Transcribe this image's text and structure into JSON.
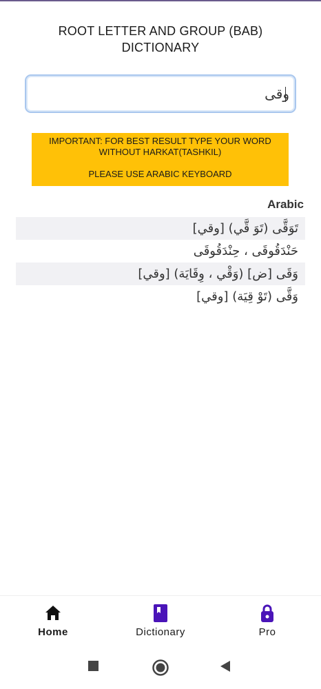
{
  "header": {
    "title_line1": "ROOT LETTER AND GROUP (BAB)",
    "title_line2": "DICTIONARY"
  },
  "search": {
    "value": "وقى",
    "border_color": "#a9c7ee"
  },
  "notice": {
    "line1": "IMPORTANT: FOR BEST RESULT TYPE YOUR WORD",
    "line2": "WITHOUT HARKAT(TASHKIL)",
    "line3": "PLEASE USE ARABIC KEYBOARD",
    "background": "#ffc107"
  },
  "results": {
    "column_header": "Arabic",
    "rows": [
      "تَوَقَّى (تَوَ قَّي) [وقي]",
      "حَنْدَقُوقَى ، حِنْدَقُوقَى",
      "وَقَى [ض] (وَقْي ، وِقَايَة) [وقي]",
      "وَقَّى (تَوْ قِيَة) [وقي]"
    ]
  },
  "bottom_nav": {
    "items": [
      {
        "label": "Home",
        "icon": "home-icon",
        "active": true,
        "color": "#111111"
      },
      {
        "label": "Dictionary",
        "icon": "book-icon",
        "active": false,
        "color": "#4a14b8"
      },
      {
        "label": "Pro",
        "icon": "lock-icon",
        "active": false,
        "color": "#4a14b8"
      }
    ]
  },
  "system_nav": {
    "buttons": [
      "recents-icon",
      "home-circle-icon",
      "back-icon"
    ]
  }
}
